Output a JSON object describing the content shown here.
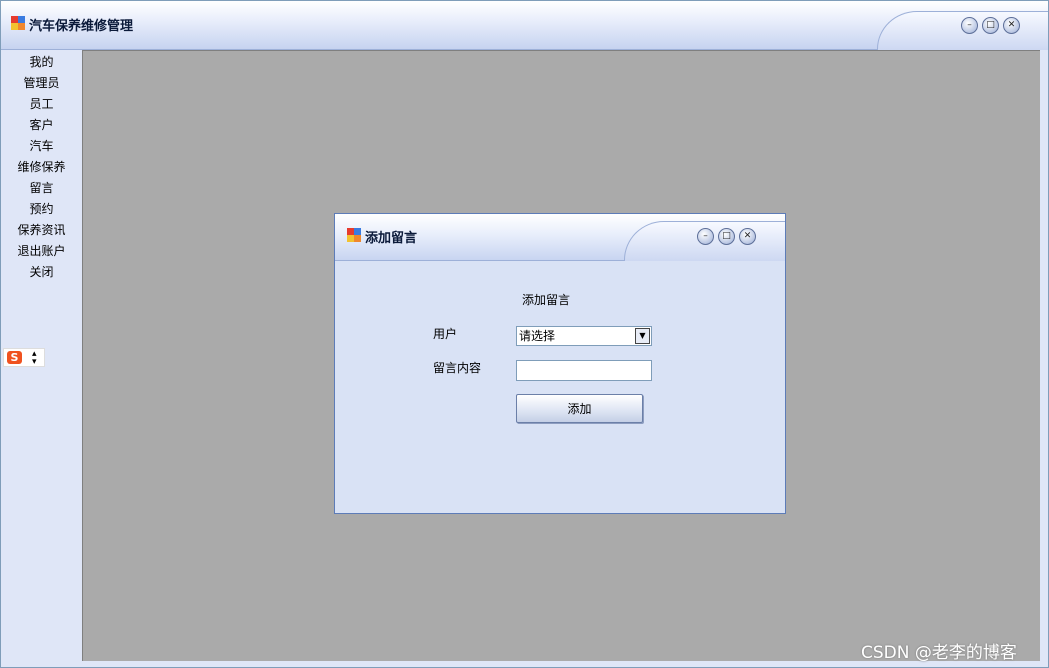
{
  "main_window": {
    "title": "汽车保养维修管理"
  },
  "sidebar": {
    "items": [
      {
        "label": "我的"
      },
      {
        "label": "管理员"
      },
      {
        "label": "员工"
      },
      {
        "label": "客户"
      },
      {
        "label": "汽车"
      },
      {
        "label": "维修保养"
      },
      {
        "label": "留言"
      },
      {
        "label": "预约"
      },
      {
        "label": "保养资讯"
      },
      {
        "label": "退出账户"
      },
      {
        "label": "关闭"
      }
    ]
  },
  "child_window": {
    "title": "添加留言",
    "form": {
      "heading": "添加留言",
      "user_label": "用户",
      "user_select_value": "请选择",
      "content_label": "留言内容",
      "content_value": "",
      "submit_label": "添加"
    }
  },
  "ime": {
    "label": "S"
  },
  "watermark": "CSDN @老李的博客",
  "colors": {
    "mdi_background": "#aaaaaa",
    "window_background": "#d9e2f5",
    "ime_accent": "#f0521f"
  }
}
